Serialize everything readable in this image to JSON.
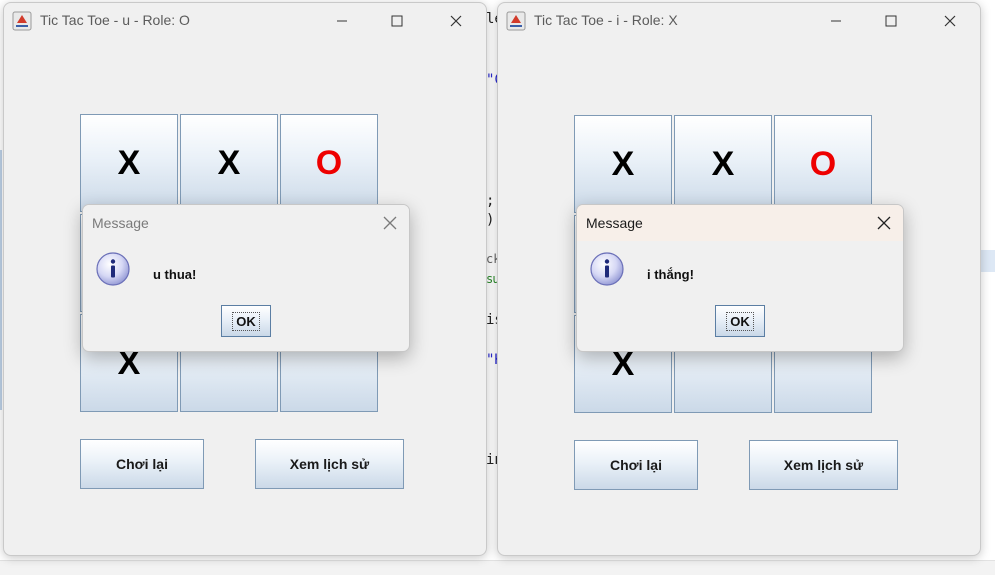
{
  "background": {
    "code_fragments": [
      {
        "text": "le",
        "color": "#222222"
      },
      {
        "text": "\"C",
        "color": "#2a2ad0"
      },
      {
        "text": ";",
        "color": "#222222"
      },
      {
        "text": ");",
        "color": "#222222"
      },
      {
        "text": "ck",
        "color": "#666666"
      },
      {
        "text": "sử",
        "color": "#2a8a2a"
      },
      {
        "text": "is",
        "color": "#222222"
      },
      {
        "text": "\"K",
        "color": "#2a2ad0"
      },
      {
        "text": "in",
        "color": "#222222"
      }
    ]
  },
  "windows": [
    {
      "title": "Tic Tac Toe - u - Role: O",
      "board": [
        "X",
        "X",
        "O",
        "",
        "",
        "",
        "X",
        "",
        ""
      ],
      "buttons": {
        "replay": "Chơi lại",
        "history": "Xem lịch sử"
      },
      "dialog": {
        "title": "Message",
        "message": "u thua!",
        "ok": "OK",
        "active": false
      }
    },
    {
      "title": "Tic Tac Toe - i - Role: X",
      "board": [
        "X",
        "X",
        "O",
        "",
        "",
        "",
        "X",
        "",
        ""
      ],
      "buttons": {
        "replay": "Chơi lại",
        "history": "Xem lịch sử"
      },
      "dialog": {
        "title": "Message",
        "message": "i thắng!",
        "ok": "OK",
        "active": true
      }
    }
  ],
  "icons": {
    "app": "java-cup-icon",
    "minimize": "minimize-icon",
    "maximize": "maximize-icon",
    "close": "close-icon",
    "info": "info-icon"
  },
  "colors": {
    "x_mark": "#000000",
    "o_mark": "#ee0000",
    "window_bg": "#f0f0f0",
    "cell_border": "#7f9ab5",
    "dialog_active_title_bg": "#f7efe9"
  }
}
